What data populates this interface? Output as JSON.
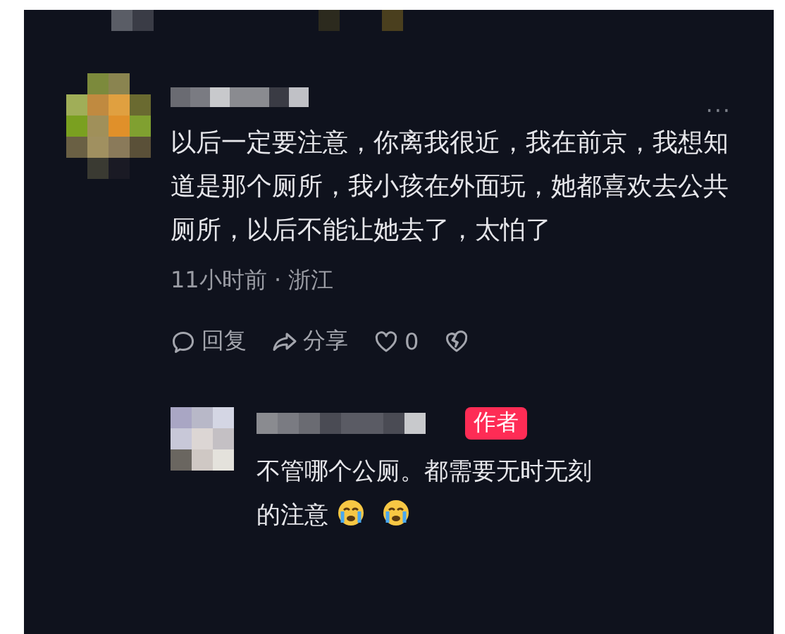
{
  "comment": {
    "text": "以后一定要注意，你离我很近，我在前京，我想知道是那个厕所，我小孩在外面玩，她都喜欢去公共厕所，以后不能让她去了，太怕了",
    "more": "···",
    "meta": "11小时前 · 浙江",
    "actions": [
      {
        "kind": "reply",
        "label": "回复"
      },
      {
        "kind": "share",
        "label": "分享"
      },
      {
        "kind": "like",
        "label": "0"
      },
      {
        "kind": "dislike"
      }
    ]
  },
  "reply": {
    "badge": "作者",
    "parts": [
      {
        "kind": "text",
        "text": "不管哪个公厕。都需要无时无刻的注意"
      },
      {
        "kind": "emoji"
      },
      {
        "kind": "emoji"
      }
    ]
  }
}
